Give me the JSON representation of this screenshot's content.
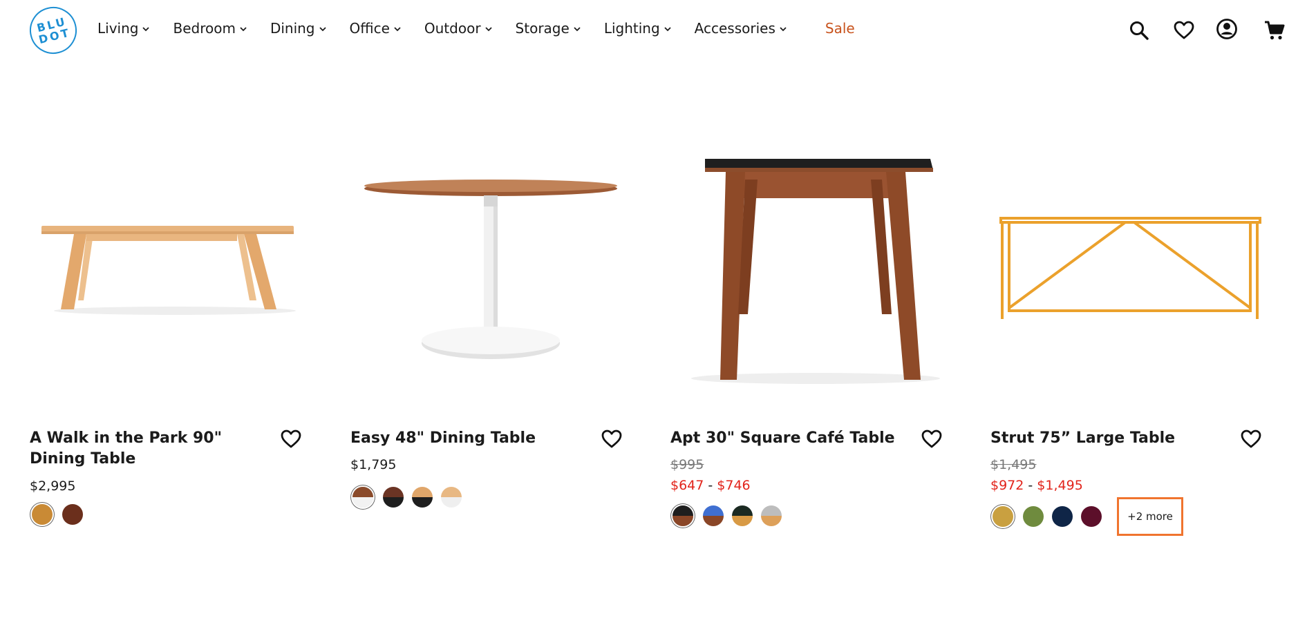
{
  "brand": {
    "logo_line1": "BLU",
    "logo_line2": "DOT",
    "logo_color": "#1d8fd3"
  },
  "nav": {
    "items": [
      {
        "label": "Living"
      },
      {
        "label": "Bedroom"
      },
      {
        "label": "Dining"
      },
      {
        "label": "Office"
      },
      {
        "label": "Outdoor"
      },
      {
        "label": "Storage"
      },
      {
        "label": "Lighting"
      },
      {
        "label": "Accessories"
      }
    ],
    "sale_label": "Sale",
    "sale_color": "#c8531d"
  },
  "header_icons": [
    "search-icon",
    "heart-icon",
    "account-icon",
    "cart-icon"
  ],
  "products": [
    {
      "name": "A Walk in the Park 90\" Dining Table",
      "price": "$2,995",
      "swatches": [
        "#c98a35",
        "#6b2f1c"
      ],
      "selected_swatch": 0
    },
    {
      "name": "Easy 48\" Dining Table",
      "price": "$1,795",
      "swatches": [
        "walnut/white",
        "walnut/black",
        "oak/black",
        "oak/white"
      ],
      "selected_swatch": 0
    },
    {
      "name": "Apt 30\" Square Café Table",
      "old_price": "$995",
      "sale_low": "$647",
      "sale_sep": " - ",
      "sale_high": "$746",
      "swatches": [
        "black/walnut",
        "blue/walnut",
        "black/oak",
        "grey/oak"
      ],
      "selected_swatch": 0
    },
    {
      "name": "Strut 75” Large Table",
      "old_price": "$1,495",
      "sale_low": "$972",
      "sale_sep": " - ",
      "sale_high": "$1,495",
      "swatches": [
        "#c9a040",
        "#6f8b3e",
        "#0f2547",
        "#5c0f2a"
      ],
      "selected_swatch": 0,
      "more_label": "+2 more"
    }
  ],
  "colors": {
    "sale_red": "#e2231a",
    "highlight_orange": "#f0742e"
  }
}
